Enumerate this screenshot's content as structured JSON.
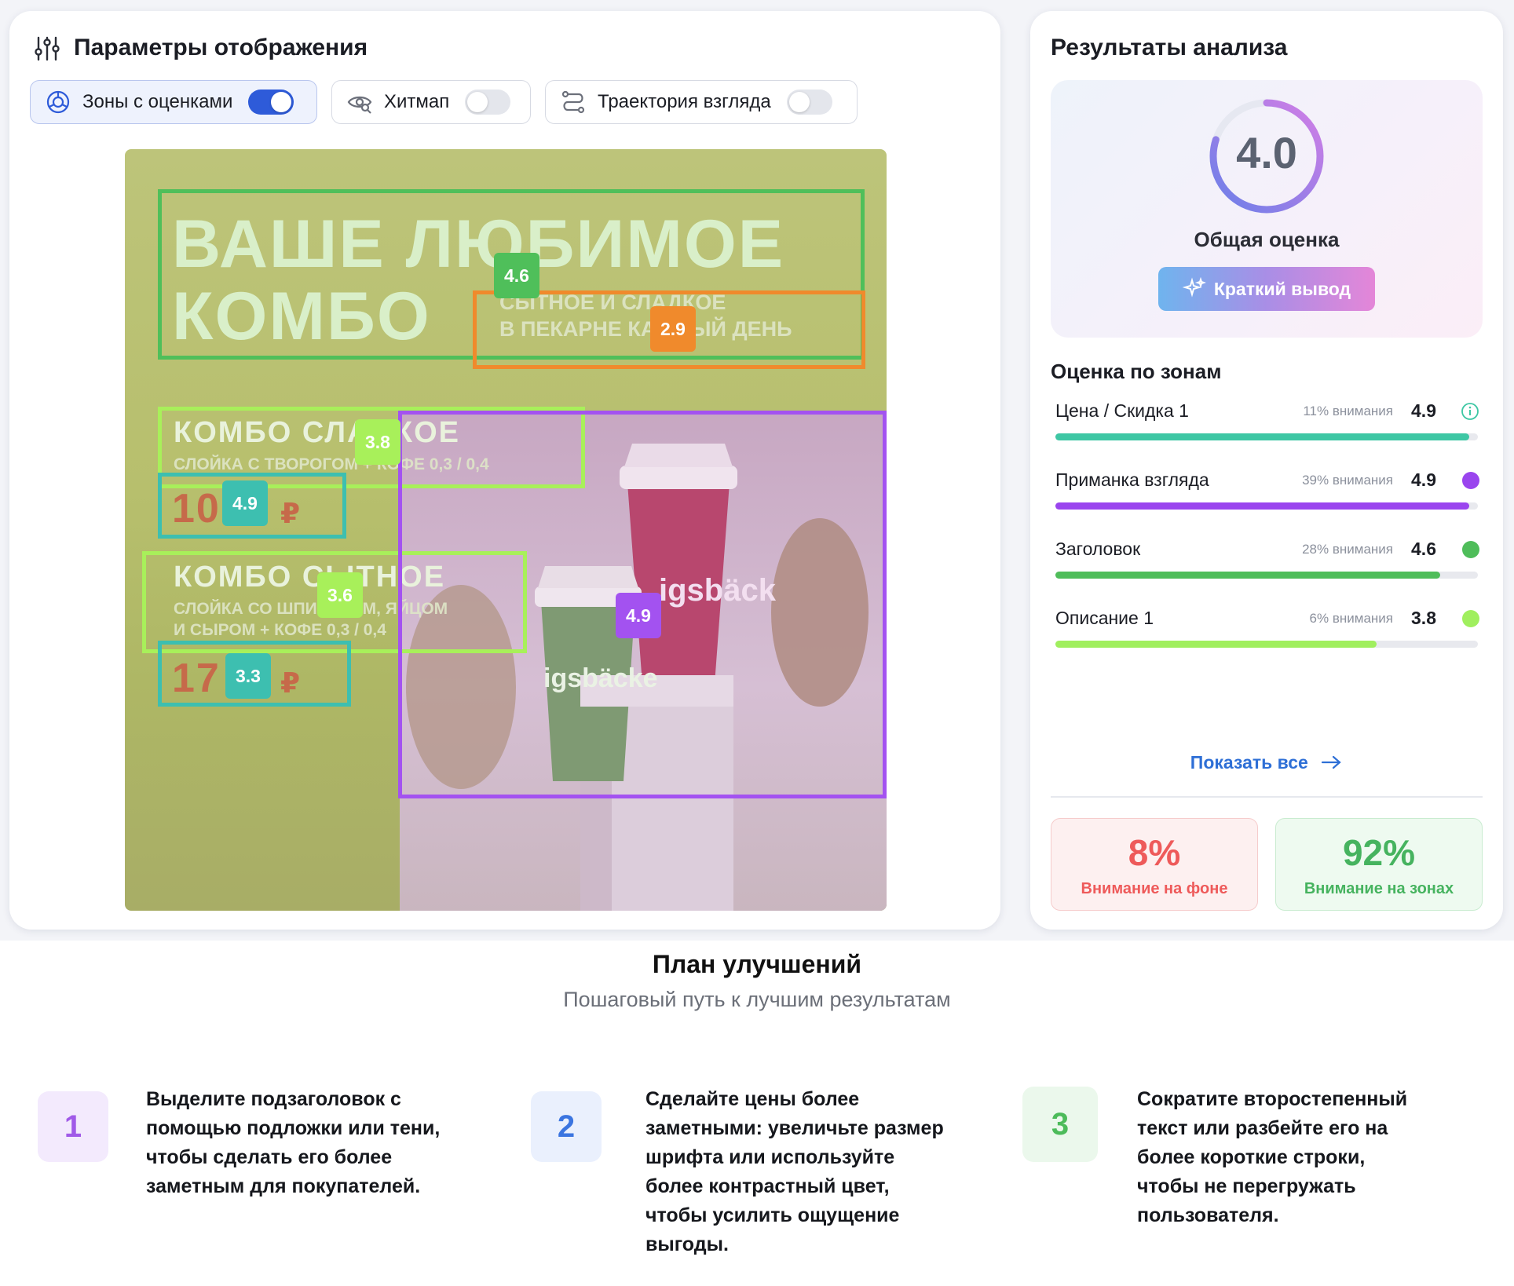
{
  "display_params": {
    "title": "Параметры отображения",
    "toggles": [
      {
        "label": "Зоны с оценками",
        "on": true,
        "icon": "target-zones-icon"
      },
      {
        "label": "Хитмап",
        "on": false,
        "icon": "eye-heatmap-icon"
      },
      {
        "label": "Траектория взгляда",
        "on": false,
        "icon": "trajectory-icon"
      }
    ]
  },
  "poster": {
    "headline_line1": "ВАШЕ  ЛЮБИМОЕ",
    "headline_line2": "КОМБО",
    "sub_line1": "СЫТНОЕ И СЛАДКОЕ",
    "sub_line2": "В ПЕКАРНЕ КАЖДЫЙ ДЕНЬ",
    "combo1_title": "КОМБО СЛАДКОЕ",
    "combo1_desc": "СЛОЙКА С ТВОРОГОМ + КОФЕ 0,3 / 0,4",
    "combo1_price": "10",
    "combo2_title": "КОМБО СЫТНОЕ",
    "combo2_desc1": "СЛОЙКА СО ШПИНАТОМ, ЯЙЦОМ",
    "combo2_desc2": "И СЫРОМ + КОФЕ 0,3 / 0,4",
    "combo2_price": "17",
    "currency": "₽",
    "cup_brand": "igsbäck",
    "cup_brand2": "igsbäcke",
    "zone_scores": {
      "headline": "4.6",
      "subheadline": "2.9",
      "combo1": "3.8",
      "price1": "4.9",
      "combo2": "3.6",
      "price2": "3.3",
      "photo": "4.9"
    },
    "colors": {
      "headline": "#4fbf5a",
      "subheadline": "#f08a2c",
      "description": "#a8f05a",
      "price": "#3dbfb0",
      "photo": "#a352f0"
    }
  },
  "results": {
    "title": "Результаты анализа",
    "overall_score": "4.0",
    "overall_score_fraction": 0.8,
    "overall_label": "Общая оценка",
    "summary_button": "Краткий вывод",
    "zones_title": "Оценка по зонам",
    "zones": [
      {
        "name": "Цена / Скидка 1",
        "attention": "11% внимания",
        "score": "4.9",
        "fill": 0.98,
        "color": "#3ec7a4",
        "marker": "info-icon"
      },
      {
        "name": "Приманка взгляда",
        "attention": "39% внимания",
        "score": "4.9",
        "fill": 0.98,
        "color": "#9a45ee",
        "marker": "dot"
      },
      {
        "name": "Заголовок",
        "attention": "28% внимания",
        "score": "4.6",
        "fill": 0.91,
        "color": "#4fbd5a",
        "marker": "dot"
      },
      {
        "name": "Описание 1",
        "attention": "6% внимания",
        "score": "3.8",
        "fill": 0.76,
        "color": "#a0ef5e",
        "marker": "dot"
      }
    ],
    "show_all": "Показать все",
    "stats": [
      {
        "value": "8%",
        "label": "Внимание на фоне",
        "color": "#ee5a5a"
      },
      {
        "value": "92%",
        "label": "Внимание на зонах",
        "color": "#46b35f"
      }
    ]
  },
  "plan": {
    "title": "План улучшений",
    "subtitle": "Пошаговый путь к лучшим результатам",
    "steps": [
      {
        "number": "1",
        "lines": [
          "Выделите подзаголовок с",
          "помощью подложки или тени,",
          "чтобы сделать его более",
          "заметным для покупателей."
        ]
      },
      {
        "number": "2",
        "lines": [
          "Сделайте цены более",
          "заметными: увеличьте размер",
          "шрифта или используйте",
          "более контрастный цвет,",
          "чтобы усилить ощущение",
          "выгоды."
        ]
      },
      {
        "number": "3",
        "lines": [
          "Сократите второстепенный",
          "текст или разбейте его на",
          "более короткие строки,",
          "чтобы не перегружать",
          "пользователя."
        ]
      }
    ]
  }
}
